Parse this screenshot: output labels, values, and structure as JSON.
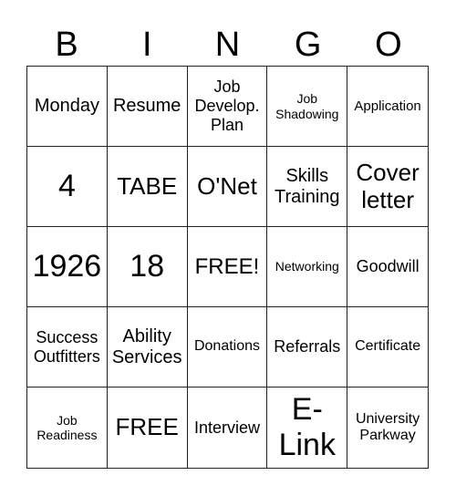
{
  "header": [
    "B",
    "I",
    "N",
    "G",
    "O"
  ],
  "cells": [
    "Monday",
    "Resume",
    "Job Develop. Plan",
    "Job Shadowing",
    "Application",
    "4",
    "TABE",
    "O'Net",
    "Skills Training",
    "Cover letter",
    "1926",
    "18",
    "FREE!",
    "Networking",
    "Goodwill",
    "Success Outfitters",
    "Ability Services",
    "Donations",
    "Referrals",
    "Certificate",
    "Job Readiness",
    "FREE",
    "Interview",
    "E-Link",
    "University Parkway"
  ]
}
